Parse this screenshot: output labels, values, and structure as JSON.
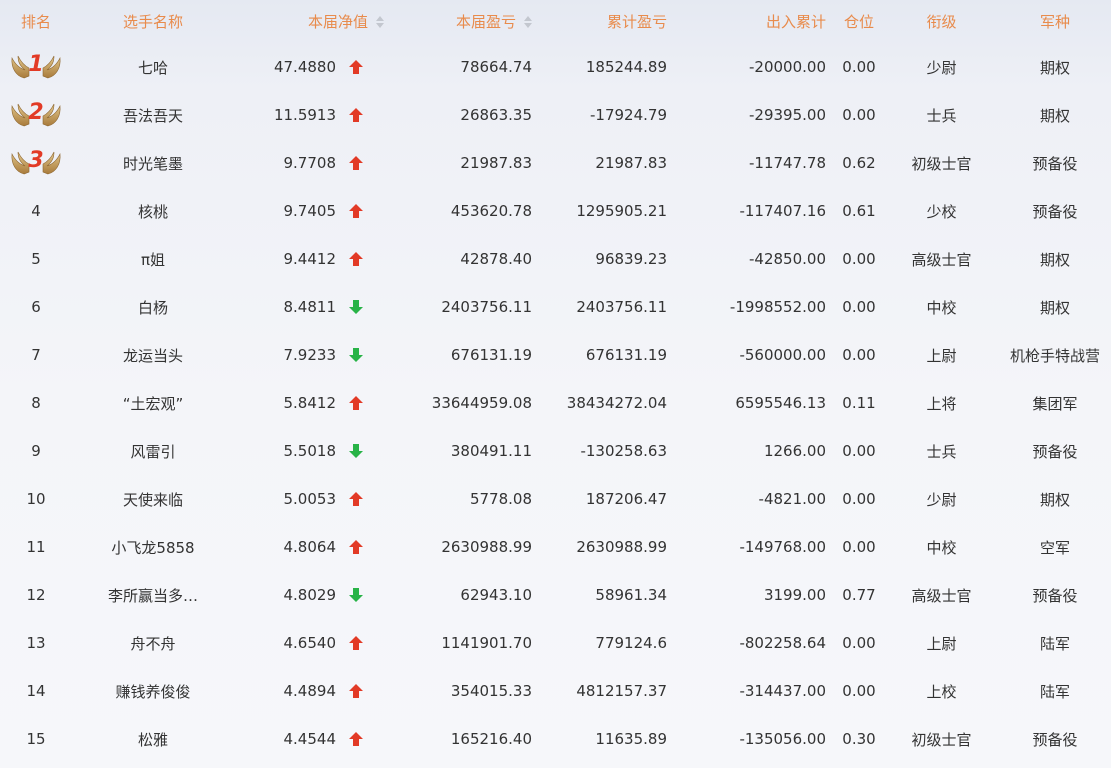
{
  "colors": {
    "header_text": "#e88b4c",
    "up_arrow": "#e23a26",
    "down_arrow": "#28b347",
    "medal_number": "#e23a26"
  },
  "table": {
    "headers": {
      "rank": "排名",
      "name": "选手名称",
      "nav": "本届净值",
      "profit": "本届盈亏",
      "total_profit": "累计盈亏",
      "io": "出入累计",
      "position": "仓位",
      "title": "衔级",
      "branch": "军种"
    },
    "sortable_columns": [
      "nav",
      "profit"
    ],
    "rows": [
      {
        "rank": "1",
        "medal": true,
        "name": "七哈",
        "nav": "47.4880",
        "trend": "up",
        "profit": "78664.74",
        "total_profit": "185244.89",
        "io": "-20000.00",
        "position": "0.00",
        "title": "少尉",
        "branch": "期权"
      },
      {
        "rank": "2",
        "medal": true,
        "name": "吾法吾天",
        "nav": "11.5913",
        "trend": "up",
        "profit": "26863.35",
        "total_profit": "-17924.79",
        "io": "-29395.00",
        "position": "0.00",
        "title": "士兵",
        "branch": "期权"
      },
      {
        "rank": "3",
        "medal": true,
        "name": "时光笔墨",
        "nav": "9.7708",
        "trend": "up",
        "profit": "21987.83",
        "total_profit": "21987.83",
        "io": "-11747.78",
        "position": "0.62",
        "title": "初级士官",
        "branch": "预备役"
      },
      {
        "rank": "4",
        "medal": false,
        "name": "核桃",
        "nav": "9.7405",
        "trend": "up",
        "profit": "453620.78",
        "total_profit": "1295905.21",
        "io": "-117407.16",
        "position": "0.61",
        "title": "少校",
        "branch": "预备役"
      },
      {
        "rank": "5",
        "medal": false,
        "name": "π姐",
        "nav": "9.4412",
        "trend": "up",
        "profit": "42878.40",
        "total_profit": "96839.23",
        "io": "-42850.00",
        "position": "0.00",
        "title": "高级士官",
        "branch": "期权"
      },
      {
        "rank": "6",
        "medal": false,
        "name": "白杨",
        "nav": "8.4811",
        "trend": "down",
        "profit": "2403756.11",
        "total_profit": "2403756.11",
        "io": "-1998552.00",
        "position": "0.00",
        "title": "中校",
        "branch": "期权"
      },
      {
        "rank": "7",
        "medal": false,
        "name": "龙运当头",
        "nav": "7.9233",
        "trend": "down",
        "profit": "676131.19",
        "total_profit": "676131.19",
        "io": "-560000.00",
        "position": "0.00",
        "title": "上尉",
        "branch": "机枪手特战营"
      },
      {
        "rank": "8",
        "medal": false,
        "name": "“土宏观”",
        "nav": "5.8412",
        "trend": "up",
        "profit": "33644959.08",
        "total_profit": "38434272.04",
        "io": "6595546.13",
        "position": "0.11",
        "title": "上将",
        "branch": "集团军"
      },
      {
        "rank": "9",
        "medal": false,
        "name": "风雷引",
        "nav": "5.5018",
        "trend": "down",
        "profit": "380491.11",
        "total_profit": "-130258.63",
        "io": "1266.00",
        "position": "0.00",
        "title": "士兵",
        "branch": "预备役"
      },
      {
        "rank": "10",
        "medal": false,
        "name": "天使来临",
        "nav": "5.0053",
        "trend": "up",
        "profit": "5778.08",
        "total_profit": "187206.47",
        "io": "-4821.00",
        "position": "0.00",
        "title": "少尉",
        "branch": "期权"
      },
      {
        "rank": "11",
        "medal": false,
        "name": "小飞龙5858",
        "nav": "4.8064",
        "trend": "up",
        "profit": "2630988.99",
        "total_profit": "2630988.99",
        "io": "-149768.00",
        "position": "0.00",
        "title": "中校",
        "branch": "空军"
      },
      {
        "rank": "12",
        "medal": false,
        "name": "李所赢当多…",
        "nav": "4.8029",
        "trend": "down",
        "profit": "62943.10",
        "total_profit": "58961.34",
        "io": "3199.00",
        "position": "0.77",
        "title": "高级士官",
        "branch": "预备役"
      },
      {
        "rank": "13",
        "medal": false,
        "name": "舟不舟",
        "nav": "4.6540",
        "trend": "up",
        "profit": "1141901.70",
        "total_profit": "779124.6",
        "io": "-802258.64",
        "position": "0.00",
        "title": "上尉",
        "branch": "陆军"
      },
      {
        "rank": "14",
        "medal": false,
        "name": "赚钱养俊俊",
        "nav": "4.4894",
        "trend": "up",
        "profit": "354015.33",
        "total_profit": "4812157.37",
        "io": "-314437.00",
        "position": "0.00",
        "title": "上校",
        "branch": "陆军"
      },
      {
        "rank": "15",
        "medal": false,
        "name": "松雅",
        "nav": "4.4544",
        "trend": "up",
        "profit": "165216.40",
        "total_profit": "11635.89",
        "io": "-135056.00",
        "position": "0.30",
        "title": "初级士官",
        "branch": "预备役"
      }
    ]
  }
}
